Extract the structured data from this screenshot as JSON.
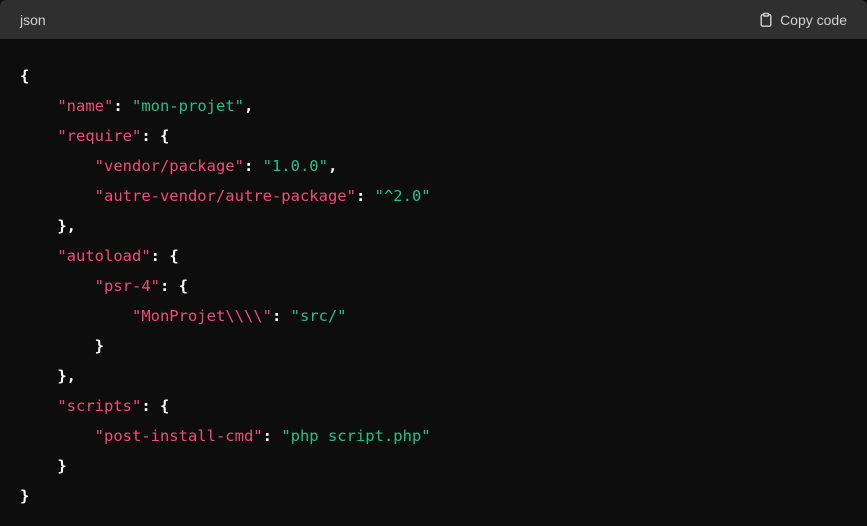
{
  "header": {
    "language": "json",
    "copy_label": "Copy code"
  },
  "code": {
    "lines": [
      {
        "indent": 0,
        "tokens": [
          {
            "t": "p",
            "v": "{"
          }
        ]
      },
      {
        "indent": 1,
        "tokens": [
          {
            "t": "k",
            "v": "\"name\""
          },
          {
            "t": "p",
            "v": ": "
          },
          {
            "t": "s",
            "v": "\"mon-projet\""
          },
          {
            "t": "p",
            "v": ","
          }
        ]
      },
      {
        "indent": 1,
        "tokens": [
          {
            "t": "k",
            "v": "\"require\""
          },
          {
            "t": "p",
            "v": ": {"
          }
        ]
      },
      {
        "indent": 2,
        "tokens": [
          {
            "t": "k",
            "v": "\"vendor/package\""
          },
          {
            "t": "p",
            "v": ": "
          },
          {
            "t": "s",
            "v": "\"1.0.0\""
          },
          {
            "t": "p",
            "v": ","
          }
        ]
      },
      {
        "indent": 2,
        "tokens": [
          {
            "t": "k",
            "v": "\"autre-vendor/autre-package\""
          },
          {
            "t": "p",
            "v": ": "
          },
          {
            "t": "s",
            "v": "\"^2.0\""
          }
        ]
      },
      {
        "indent": 1,
        "tokens": [
          {
            "t": "p",
            "v": "},"
          }
        ]
      },
      {
        "indent": 1,
        "tokens": [
          {
            "t": "k",
            "v": "\"autoload\""
          },
          {
            "t": "p",
            "v": ": {"
          }
        ]
      },
      {
        "indent": 2,
        "tokens": [
          {
            "t": "k",
            "v": "\"psr-4\""
          },
          {
            "t": "p",
            "v": ": {"
          }
        ]
      },
      {
        "indent": 3,
        "tokens": [
          {
            "t": "k",
            "v": "\"MonProjet\\\\\\\\\""
          },
          {
            "t": "p",
            "v": ": "
          },
          {
            "t": "s",
            "v": "\"src/\""
          }
        ]
      },
      {
        "indent": 2,
        "tokens": [
          {
            "t": "p",
            "v": "}"
          }
        ]
      },
      {
        "indent": 1,
        "tokens": [
          {
            "t": "p",
            "v": "},"
          }
        ]
      },
      {
        "indent": 1,
        "tokens": [
          {
            "t": "k",
            "v": "\"scripts\""
          },
          {
            "t": "p",
            "v": ": {"
          }
        ]
      },
      {
        "indent": 2,
        "tokens": [
          {
            "t": "k",
            "v": "\"post-install-cmd\""
          },
          {
            "t": "p",
            "v": ": "
          },
          {
            "t": "s",
            "v": "\"php script.php\""
          }
        ]
      },
      {
        "indent": 1,
        "tokens": [
          {
            "t": "p",
            "v": "}"
          }
        ]
      },
      {
        "indent": 0,
        "tokens": [
          {
            "t": "p",
            "v": "}"
          }
        ]
      }
    ]
  },
  "icons": {
    "copy": "clipboard-icon"
  },
  "colors": {
    "key": "#ef4b7d",
    "string": "#1ec28b",
    "punctuation": "#ffffff",
    "header_bg": "#2f2f2f",
    "body_bg": "#0d0d0d"
  }
}
